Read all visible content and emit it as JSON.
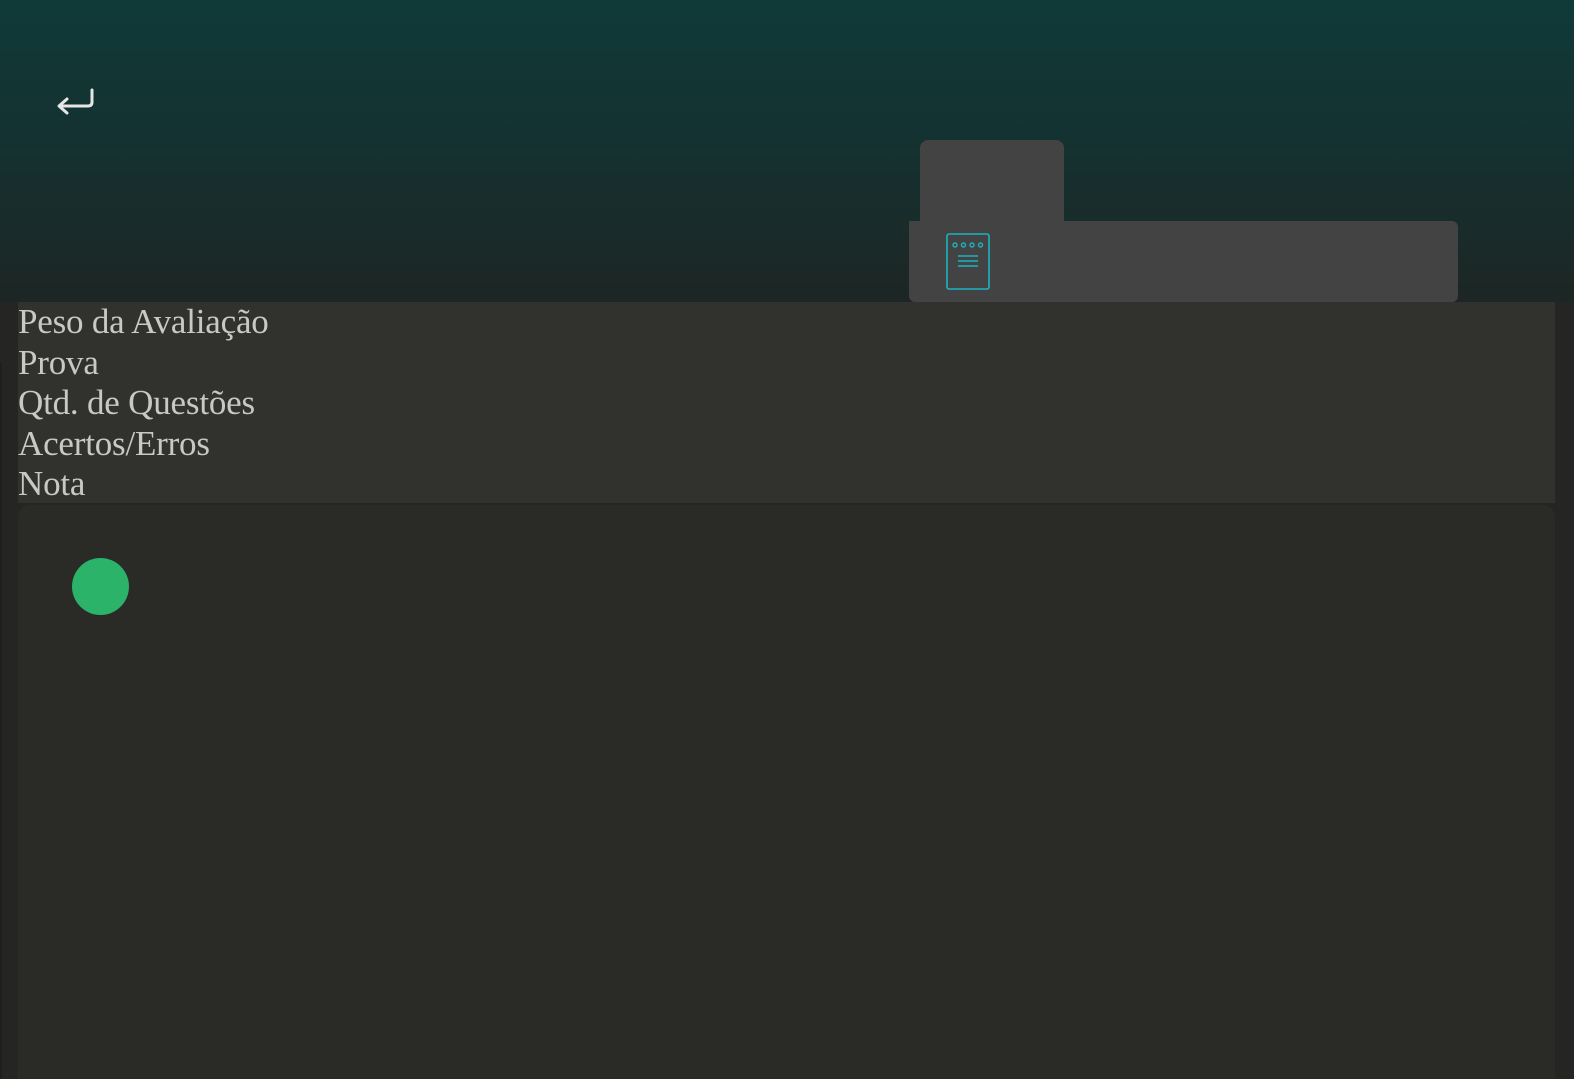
{
  "header": {
    "back_icon": "return-arrow-icon"
  },
  "info_card": {
    "icon": "document-icon",
    "icon_color": "#19b5c2"
  },
  "evaluation_labels": [
    "Peso da Avaliação",
    "Prova",
    "Qtd. de Questões",
    "Acertos/Erros",
    "Nota"
  ],
  "status": {
    "icon": "status-dot-icon",
    "color": "#2bb36a"
  }
}
